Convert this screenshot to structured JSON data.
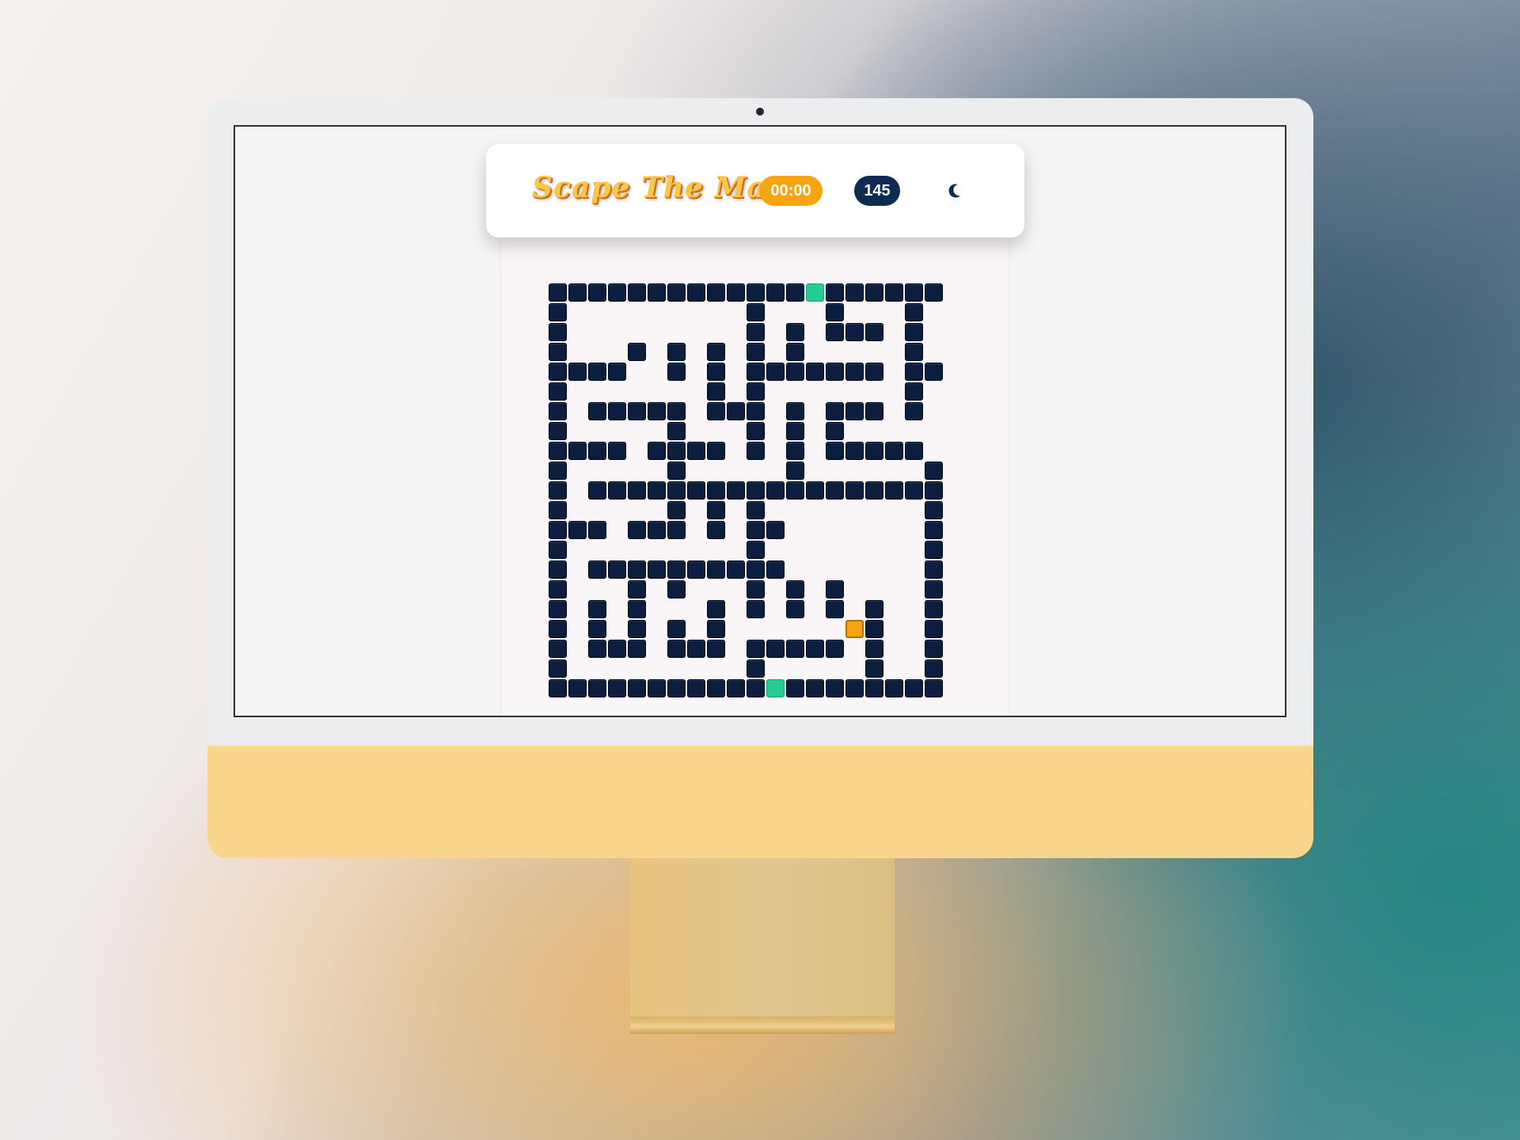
{
  "app": {
    "title": "Scape The Maze",
    "timer": "00:00",
    "moves": "145",
    "theme_icon": "moon-icon"
  },
  "colors": {
    "wall": "#0c1e40",
    "door": "#27cc95",
    "player": "#f6a40f",
    "timer_bg": "#f6a40f",
    "moves_bg": "#0c2a52"
  },
  "maze": {
    "rows": [
      "#############.######",
      "#.........#...#...#.",
      "#.........#.#.###.#.",
      "#...#.#.#.#.#.....#.",
      "####..#.#.#######.##",
      "#.......#.#.......#.",
      "#.#####.###.#.###.#.",
      "#.....#...#.#.#.....",
      "####.####.#.#.#####.",
      "#.....#.....#......#",
      "#.##################",
      "#.....#.#.#........#",
      "###.###.#.##.......#",
      "#.........#........#",
      "#.##########.......#",
      "#...#.#...#.#.#....#",
      "#.#.#...#.#.#.#.#..#",
      "#.#.#.#.#.......#..#",
      "#.###.###.#####.#..#",
      "#.........#.....#..#",
      "###########.########"
    ],
    "player": [
      17,
      15
    ],
    "exits": [
      [
        0,
        13
      ],
      [
        20,
        11
      ]
    ]
  }
}
